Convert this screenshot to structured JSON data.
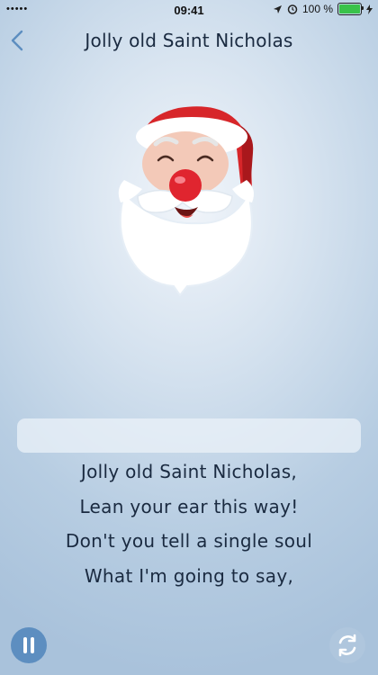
{
  "status": {
    "time": "09:41",
    "battery_text": "100 %",
    "battery_level": 1.0
  },
  "nav": {
    "title": "Jolly old Saint Nicholas"
  },
  "lyrics": [
    "Jolly old Saint Nicholas,",
    "Lean your ear this way!",
    "Don't you tell a single soul",
    "What I'm going to say,"
  ],
  "colors": {
    "accent": "#5d8ec0",
    "battery": "#39c24a",
    "santa_hat": "#d7262a",
    "santa_nose": "#e0252f"
  },
  "icons": {
    "back": "chevron-left",
    "pause": "pause",
    "refresh": "refresh"
  }
}
